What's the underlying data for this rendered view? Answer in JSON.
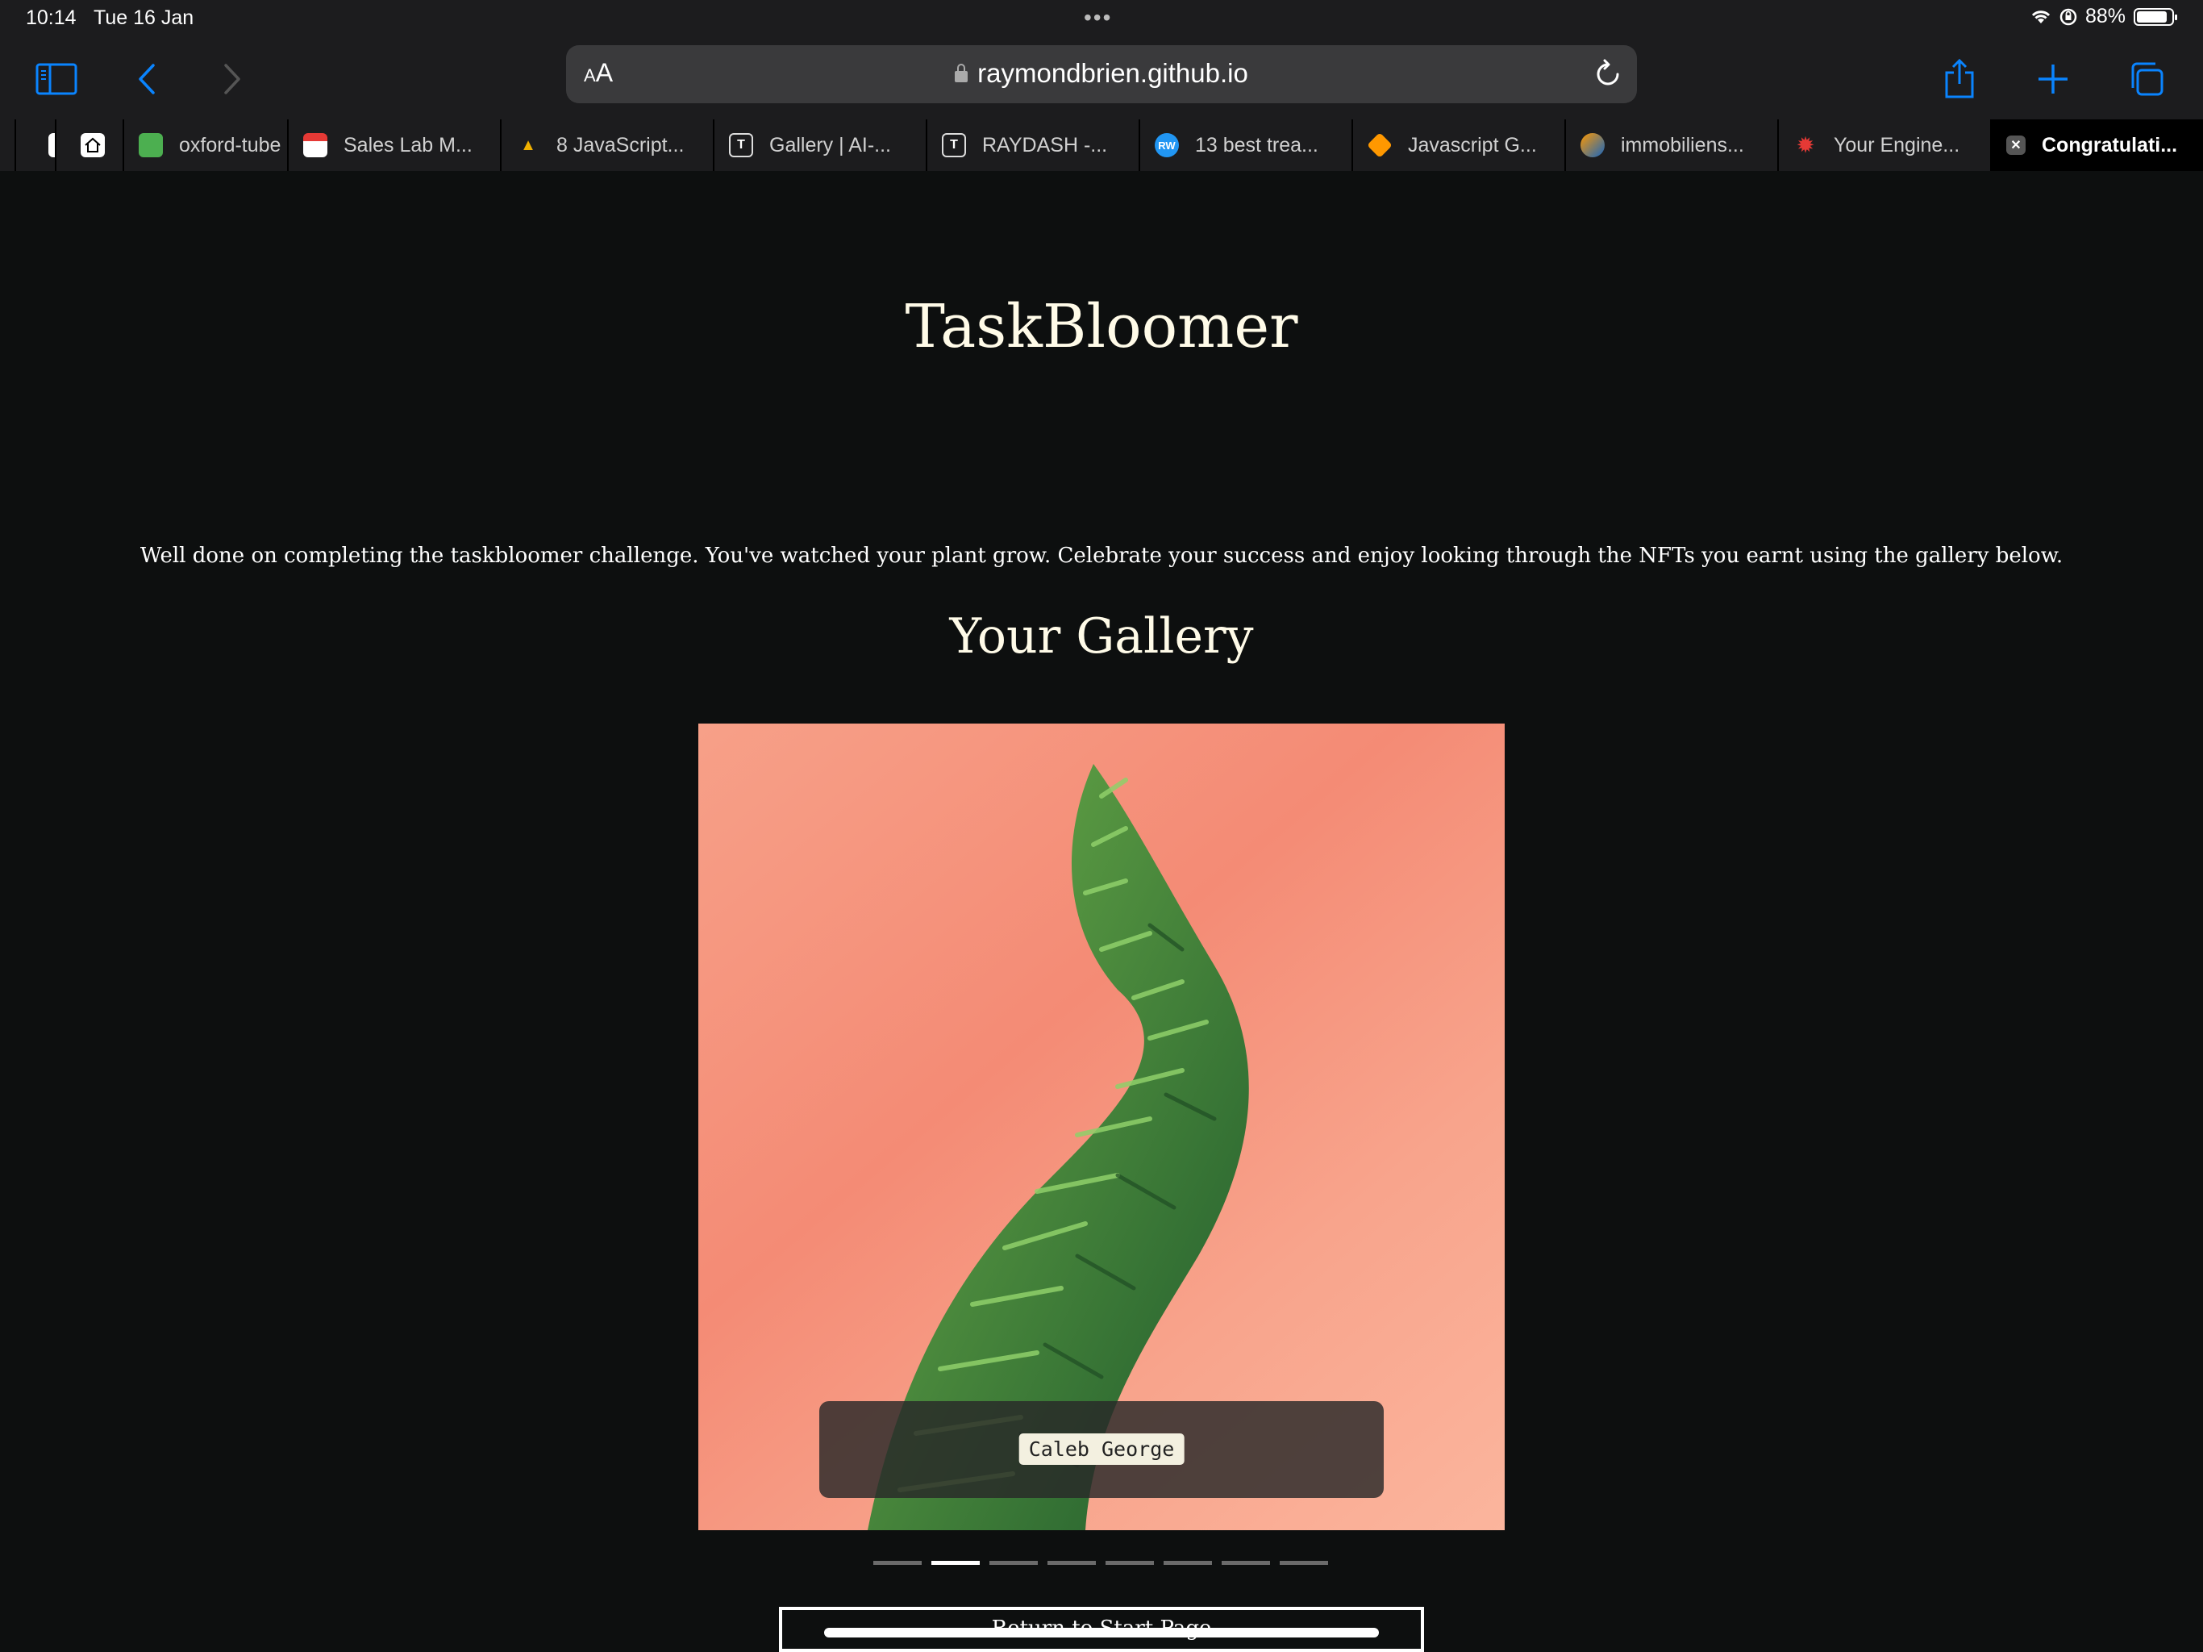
{
  "status_bar": {
    "time": "10:14",
    "date": "Tue 16 Jan",
    "battery": "88%",
    "battery_level": 0.88,
    "dots": "•••"
  },
  "toolbar": {
    "text_size_label": "AA",
    "url": "raymondbrien.github.io",
    "accent_color": "#0a84ff"
  },
  "tabs": [
    {
      "label": "",
      "icon": "generic-tab-icon"
    },
    {
      "label": "",
      "icon": "home-icon"
    },
    {
      "label": "oxford-tube",
      "icon": "tube-icon"
    },
    {
      "label": "Sales Lab M...",
      "icon": "sales-lab-icon"
    },
    {
      "label": "8 JavaScript...",
      "icon": "graduation-cap-icon"
    },
    {
      "label": "Gallery | AI-...",
      "icon": "t-icon"
    },
    {
      "label": "RAYDASH -...",
      "icon": "t-icon"
    },
    {
      "label": "13 best trea...",
      "icon": "rw-icon"
    },
    {
      "label": "Javascript G...",
      "icon": "diamond-icon"
    },
    {
      "label": "immobiliens...",
      "icon": "swirl-icon"
    },
    {
      "label": "Your Engine...",
      "icon": "gear-icon"
    },
    {
      "label": "Congratulati...",
      "icon": "close-icon",
      "active": true
    }
  ],
  "page": {
    "site_title": "TaskBloomer",
    "message": "Well done on completing the taskbloomer challenge. You've watched your plant grow. Celebrate your success and enjoy looking through the NFTs you earnt using the gallery below.",
    "gallery_title": "Your Gallery",
    "slide_caption": "Caleb George",
    "slide_count": 8,
    "active_slide": 2,
    "return_button": "Return to Start Page"
  }
}
